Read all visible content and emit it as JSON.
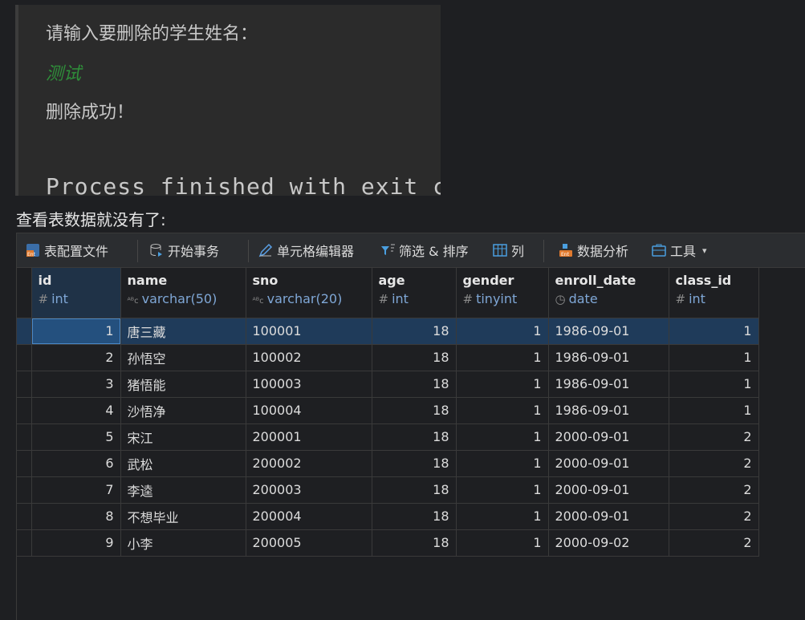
{
  "console": {
    "prompt": "请输入要删除的学生姓名：",
    "user_input": "测试",
    "result": "删除成功！",
    "exit_line": "Process finished with exit c"
  },
  "caption": "查看表数据就没有了:",
  "toolbar": {
    "items": [
      {
        "label": "表配置文件",
        "icon": "table-config-icon"
      },
      {
        "label": "开始事务",
        "icon": "transaction-icon"
      },
      {
        "label": "单元格编辑器",
        "icon": "edit-pencil-icon"
      },
      {
        "label": "筛选 & 排序",
        "icon": "filter-sort-icon"
      },
      {
        "label": "列",
        "icon": "columns-icon"
      },
      {
        "label": "数据分析",
        "icon": "data-analysis-icon"
      },
      {
        "label": "工具",
        "icon": "tools-icon"
      }
    ]
  },
  "colors": {
    "background": "#1e1f22",
    "selection": "#1f3b5a",
    "type_text": "#7fa7d6",
    "input_green": "#2f8f3a"
  },
  "table": {
    "columns": [
      {
        "name": "id",
        "type": "int",
        "glyph": "#"
      },
      {
        "name": "name",
        "type": "varchar(50)",
        "glyph": "ABC"
      },
      {
        "name": "sno",
        "type": "varchar(20)",
        "glyph": "ABC"
      },
      {
        "name": "age",
        "type": "int",
        "glyph": "#"
      },
      {
        "name": "gender",
        "type": "tinyint",
        "glyph": "#"
      },
      {
        "name": "enroll_date",
        "type": "date",
        "glyph": "clock"
      },
      {
        "name": "class_id",
        "type": "int",
        "glyph": "#"
      }
    ],
    "rows": [
      [
        "1",
        "唐三藏",
        "100001",
        "18",
        "1",
        "1986-09-01",
        "1"
      ],
      [
        "2",
        "孙悟空",
        "100002",
        "18",
        "1",
        "1986-09-01",
        "1"
      ],
      [
        "3",
        "猪悟能",
        "100003",
        "18",
        "1",
        "1986-09-01",
        "1"
      ],
      [
        "4",
        "沙悟净",
        "100004",
        "18",
        "1",
        "1986-09-01",
        "1"
      ],
      [
        "5",
        "宋江",
        "200001",
        "18",
        "1",
        "2000-09-01",
        "2"
      ],
      [
        "6",
        "武松",
        "200002",
        "18",
        "1",
        "2000-09-01",
        "2"
      ],
      [
        "7",
        "李逵",
        "200003",
        "18",
        "1",
        "2000-09-01",
        "2"
      ],
      [
        "8",
        "不想毕业",
        "200004",
        "18",
        "1",
        "2000-09-01",
        "2"
      ],
      [
        "9",
        "小李",
        "200005",
        "18",
        "1",
        "2000-09-02",
        "2"
      ]
    ]
  }
}
